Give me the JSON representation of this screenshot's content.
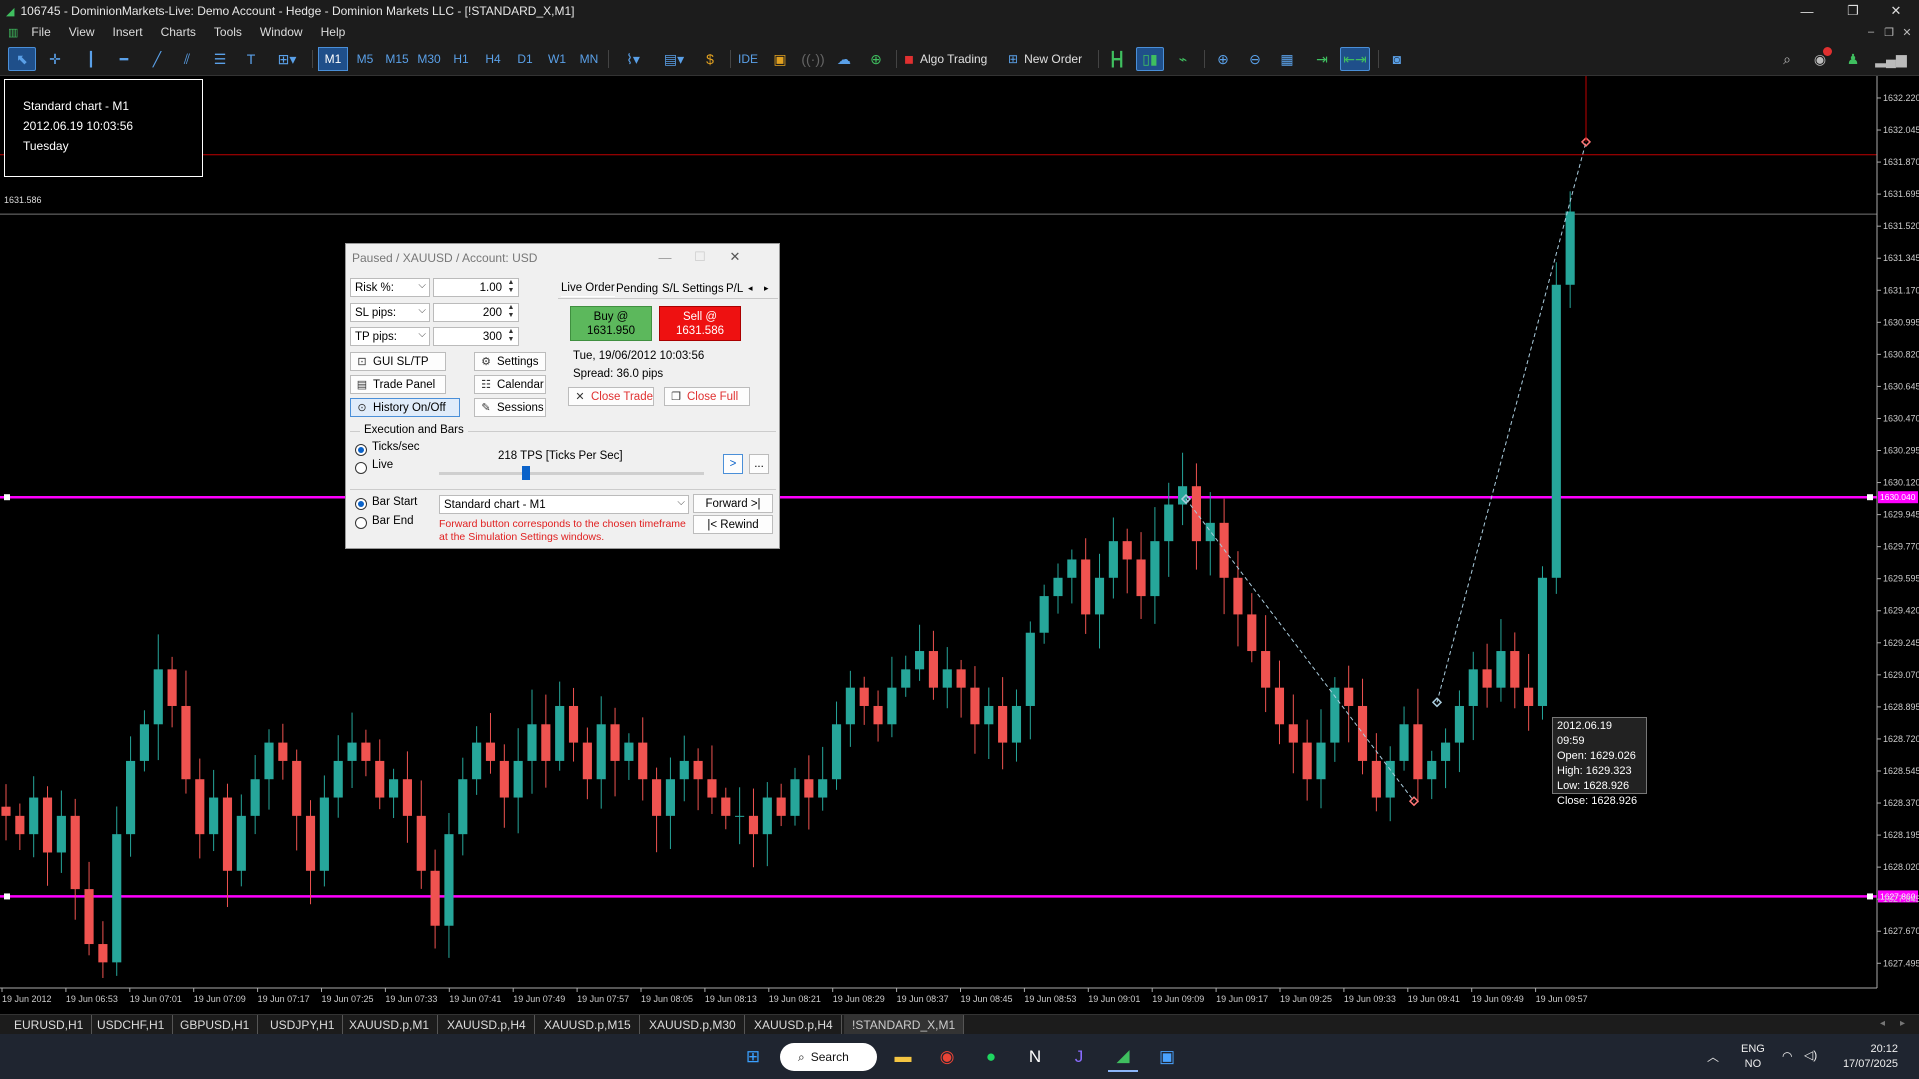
{
  "window": {
    "title": "106745 - DominionMarkets-Live: Demo Account - Hedge - Dominion Markets LLC - [!STANDARD_X,M1]",
    "controls": [
      "—",
      "❐",
      "✕"
    ]
  },
  "menu": {
    "items": [
      "File",
      "View",
      "Insert",
      "Charts",
      "Tools",
      "Window",
      "Help"
    ],
    "mdi_controls": [
      "–",
      "❐",
      "✕"
    ]
  },
  "toolbar": {
    "timeframes": [
      "M1",
      "M5",
      "M15",
      "M30",
      "H1",
      "H4",
      "D1",
      "W1",
      "MN"
    ],
    "selected_timeframe": "M1",
    "ide_label": "IDE",
    "algo_trading": "Algo Trading",
    "new_order": "New Order"
  },
  "info_box": {
    "line1": "Standard chart - M1",
    "line2": "2012.06.19 10:03:56",
    "line3": "Tuesday"
  },
  "chart_data": {
    "type": "candlestick",
    "current_price_label": "1631.586",
    "y_ticks": [
      "1632.220",
      "1632.045",
      "1631.870",
      "1631.695",
      "1631.520",
      "1631.345",
      "1631.170",
      "1630.995",
      "1630.820",
      "1630.645",
      "1630.470",
      "1630.295",
      "1630.120",
      "1629.945",
      "1629.770",
      "1629.595",
      "1629.420",
      "1629.245",
      "1629.070",
      "1628.895",
      "1628.720",
      "1628.545",
      "1628.370",
      "1628.195",
      "1628.020",
      "1627.845",
      "1627.670",
      "1627.495"
    ],
    "ylim": [
      1627.36,
      1632.34
    ],
    "x_ticks": [
      "19 Jun 2012",
      "19 Jun 06:53",
      "19 Jun 07:01",
      "19 Jun 07:09",
      "19 Jun 07:17",
      "19 Jun 07:25",
      "19 Jun 07:33",
      "19 Jun 07:41",
      "19 Jun 07:49",
      "19 Jun 07:57",
      "19 Jun 08:05",
      "19 Jun 08:13",
      "19 Jun 08:21",
      "19 Jun 08:29",
      "19 Jun 08:37",
      "19 Jun 08:45",
      "19 Jun 08:53",
      "19 Jun 09:01",
      "19 Jun 09:09",
      "19 Jun 09:17",
      "19 Jun 09:25",
      "19 Jun 09:33",
      "19 Jun 09:41",
      "19 Jun 09:49",
      "19 Jun 09:57"
    ],
    "hlines": [
      {
        "price": 1630.04,
        "color": "#ff00ff",
        "label": "1630.040"
      },
      {
        "price": 1627.86,
        "color": "#ff00ff",
        "label": "1627.860"
      },
      {
        "price": 1631.91,
        "color": "#c00000",
        "label": ""
      },
      {
        "price": 1631.586,
        "color": "#777777",
        "label": ""
      }
    ],
    "candles_close_path": [
      1628.3,
      1628.2,
      1628.4,
      1628.1,
      1628.3,
      1627.9,
      1627.6,
      1627.5,
      1628.2,
      1628.6,
      1628.8,
      1629.1,
      1628.9,
      1628.5,
      1628.2,
      1628.4,
      1628.0,
      1628.3,
      1628.5,
      1628.7,
      1628.6,
      1628.3,
      1628.0,
      1628.4,
      1628.6,
      1628.7,
      1628.6,
      1628.4,
      1628.5,
      1628.3,
      1628.0,
      1627.7,
      1628.2,
      1628.5,
      1628.7,
      1628.6,
      1628.4,
      1628.6,
      1628.8,
      1628.6,
      1628.9,
      1628.7,
      1628.5,
      1628.8,
      1628.6,
      1628.7,
      1628.5,
      1628.3,
      1628.5,
      1628.6,
      1628.5,
      1628.4,
      1628.3,
      1628.3,
      1628.2,
      1628.4,
      1628.3,
      1628.5,
      1628.4,
      1628.5,
      1628.8,
      1629.0,
      1628.9,
      1628.8,
      1629.0,
      1629.1,
      1629.2,
      1629.0,
      1629.1,
      1629.0,
      1628.8,
      1628.9,
      1628.7,
      1628.9,
      1629.3,
      1629.5,
      1629.6,
      1629.7,
      1629.4,
      1629.6,
      1629.8,
      1629.7,
      1629.5,
      1629.8,
      1630.0,
      1630.1,
      1629.8,
      1629.9,
      1629.6,
      1629.4,
      1629.2,
      1629.0,
      1628.8,
      1628.7,
      1628.5,
      1628.7,
      1629.0,
      1628.9,
      1628.6,
      1628.4,
      1628.6,
      1628.8,
      1628.5,
      1628.6,
      1628.7,
      1628.9,
      1629.1,
      1629.0,
      1629.2,
      1629.0,
      1628.9,
      1629.6,
      1631.2,
      1631.6
    ],
    "tooltip": {
      "date": "2012.06.19 09:59",
      "open": "Open: 1629.026",
      "high": "High: 1629.323",
      "low": "Low: 1628.926",
      "close": "Close: 1628.926"
    }
  },
  "trade_panel": {
    "title": "Paused / XAUUSD / Account: USD",
    "window_buttons": [
      "—",
      "☐",
      "✕"
    ],
    "risk_label": "Risk %:",
    "risk_value": "1.00",
    "sl_label": "SL pips:",
    "sl_value": "200",
    "tp_label": "TP pips:",
    "tp_value": "300",
    "gui_sltp": "GUI SL/TP",
    "settings": "Settings",
    "trade_panel": "Trade Panel",
    "calendar": "Calendar",
    "history": "History On/Off",
    "sessions": "Sessions",
    "tabs": [
      "Live Order",
      "Pending",
      "S/L Settings",
      "P/L"
    ],
    "buy_line1": "Buy @",
    "buy_line2": "1631.950",
    "sell_line1": "Sell @",
    "sell_line2": "1631.586",
    "datetime": "Tue, 19/06/2012  10:03:56",
    "spread": "Spread: 36.0 pips",
    "close_trade": "Close Trade",
    "close_full": "Close Full",
    "exec_group": "Execution and Bars",
    "ticks_label": "Ticks/sec",
    "live_label": "Live",
    "tps_label": "218 TPS [Ticks Per Sec]",
    "speed_level": 0.33,
    "next_btn": ">",
    "more_btn": "...",
    "bar_start": "Bar Start",
    "bar_end": "Bar End",
    "chart_select": "Standard chart - M1",
    "forward": "Forward >|",
    "rewind": "|< Rewind",
    "note_line1": "Forward button corresponds to the chosen timeframe",
    "note_line2": "at the Simulation Settings windows."
  },
  "chart_tabs": [
    "EURUSD,H1",
    "USDCHF,H1",
    "GBPUSD,H1",
    "USDJPY,H1",
    "XAUUSD.p,M1",
    "XAUUSD.p,H4",
    "XAUUSD.p,M15",
    "XAUUSD.p,M30",
    "XAUUSD.p,H4",
    "!STANDARD_X,M1"
  ],
  "active_chart_tab": "!STANDARD_X,M1",
  "taskbar": {
    "search": "Search",
    "lang1": "ENG",
    "lang2": "NO",
    "time": "20:12",
    "date": "17/07/2025"
  },
  "colors": {
    "bull": "#26a69a",
    "bear": "#ef5350",
    "magenta": "#ff00ff",
    "buy_bg": "#5cb85c",
    "sell_bg": "#ee1111"
  }
}
